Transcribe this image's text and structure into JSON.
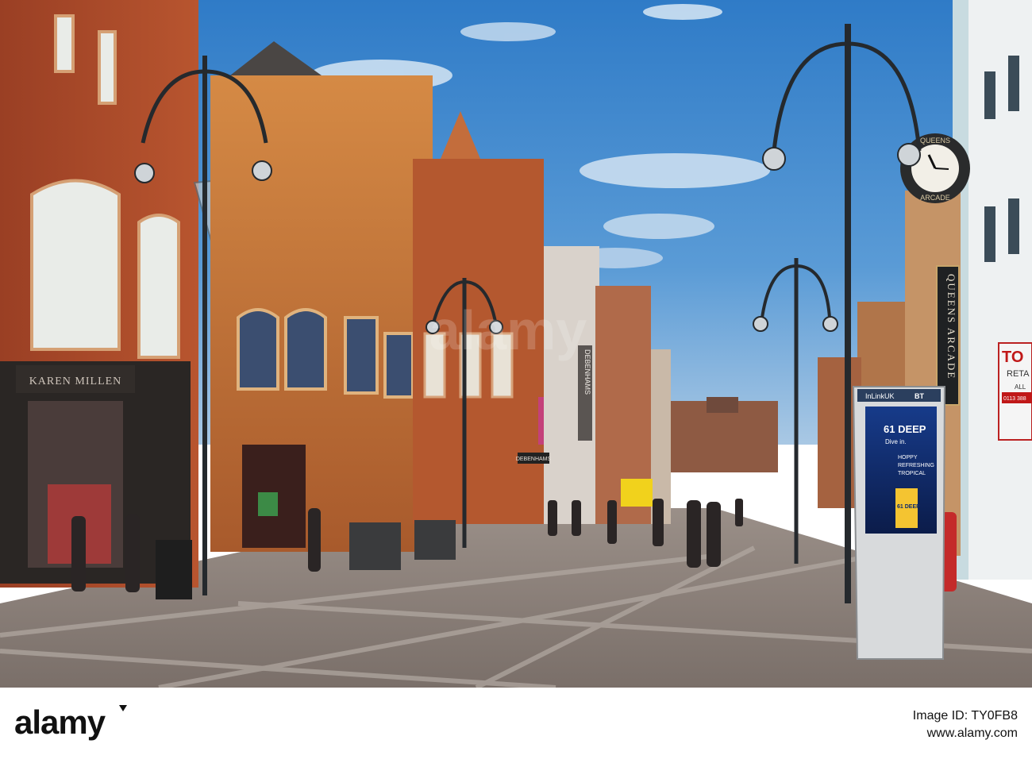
{
  "scene": {
    "description_colors": {
      "sky": "#3f86c9",
      "brick": "#b5502c",
      "sandstone": "#c9823e",
      "pavement": "#8a7f78",
      "lamp": "#2b2f33"
    },
    "signs": {
      "karen_millen": "KAREN MILLEN",
      "debenhams_vertical": "DEBENHAMS",
      "debenhams_shop": "DEBENHAMS",
      "queens_arcade": "QUEENS ARCADE",
      "clock_top": "QUEENS",
      "clock_bottom": "ARCADE",
      "kiosk_brand": "InLinkUK",
      "kiosk_bt": "BT",
      "kiosk_ad_title": "61 DEEP",
      "kiosk_ad_sub": "Dive in.",
      "kiosk_ad_line1": "HOPPY",
      "kiosk_ad_line2": "REFRESHING",
      "kiosk_ad_line3": "TROPICAL",
      "kiosk_can": "61 DEEP",
      "to_let_1": "TO",
      "to_let_2": "RETA",
      "to_let_3": "ALL",
      "to_let_phone": "0113 388"
    }
  },
  "footer": {
    "logo": "alamy",
    "image_id_label": "Image ID: TY0FB8",
    "url": "www.alamy.com"
  },
  "watermark": "alamy"
}
